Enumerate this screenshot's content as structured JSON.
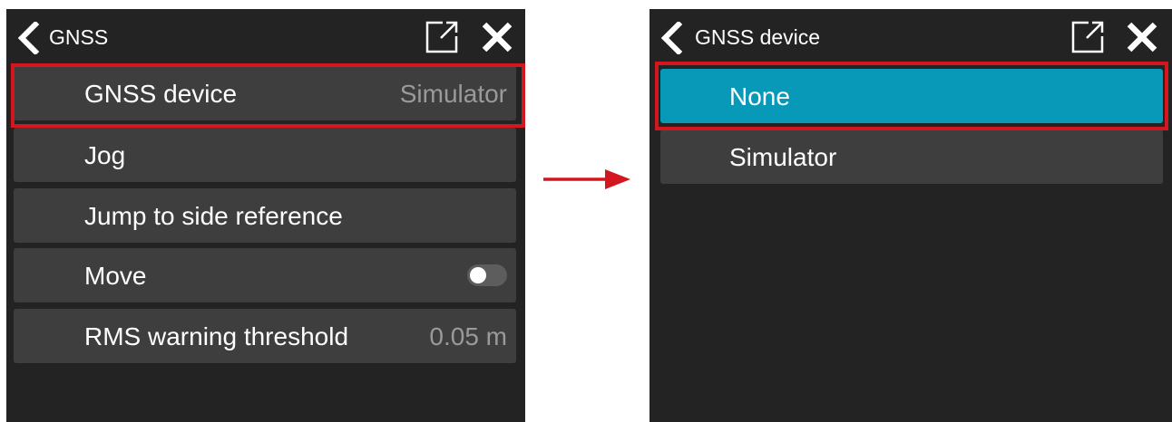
{
  "colors": {
    "panel_background": "#232323",
    "item_background": "#3e3e3e",
    "selected_background": "#0898b8",
    "highlight": "#d4161f",
    "value_text": "#9a9a9a"
  },
  "left_panel": {
    "title": "GNSS",
    "items": [
      {
        "label": "GNSS device",
        "value": "Simulator"
      },
      {
        "label": "Jog"
      },
      {
        "label": "Jump to side reference"
      },
      {
        "label": "Move",
        "toggle": {
          "on": false
        }
      },
      {
        "label": "RMS warning threshold",
        "value": "0.05 m"
      }
    ]
  },
  "right_panel": {
    "title": "GNSS device",
    "options": [
      {
        "label": "None",
        "selected": true
      },
      {
        "label": "Simulator",
        "selected": false
      }
    ]
  },
  "icons": {
    "back": "chevron-left-icon",
    "popout": "open-external-icon",
    "close": "close-icon",
    "transition": "right-arrow-icon"
  }
}
